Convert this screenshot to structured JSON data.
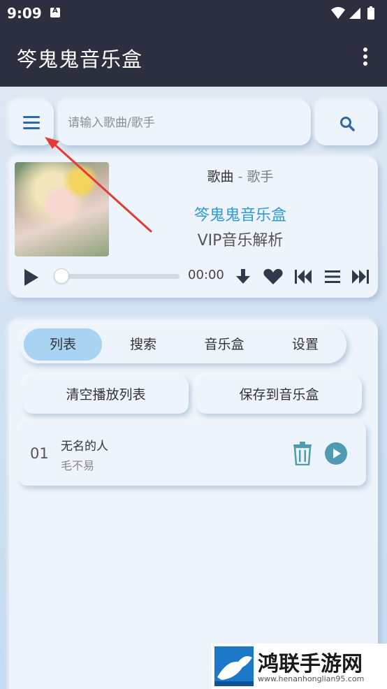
{
  "status_bar": {
    "time": "9:09"
  },
  "app_bar": {
    "title": "笒鬼鬼音乐盒"
  },
  "search": {
    "placeholder": "请输入歌曲/歌手"
  },
  "player": {
    "song": "歌曲",
    "separator": " - ",
    "artist": "歌手",
    "brand": "笒鬼鬼音乐盒",
    "subtitle": "VIP音乐解析",
    "time": "00:00",
    "progress": 0
  },
  "tabs": [
    {
      "label": "列表",
      "active": true
    },
    {
      "label": "搜索",
      "active": false
    },
    {
      "label": "音乐盒",
      "active": false
    },
    {
      "label": "设置",
      "active": false
    }
  ],
  "actions": {
    "clear_label": "清空播放列表",
    "save_label": "保存到音乐盒"
  },
  "playlist": [
    {
      "index": "01",
      "name": "无名的人",
      "singer": "毛不易"
    }
  ],
  "watermark": {
    "name": "鸿联手游网",
    "url": "www.henanhonglian95.com"
  },
  "colors": {
    "appbar": "#2b2f3f",
    "accent": "#2f9ad6",
    "icon": "#2e6aa3",
    "active_tab": "#a9d3f3",
    "annotation": "#e53935"
  }
}
